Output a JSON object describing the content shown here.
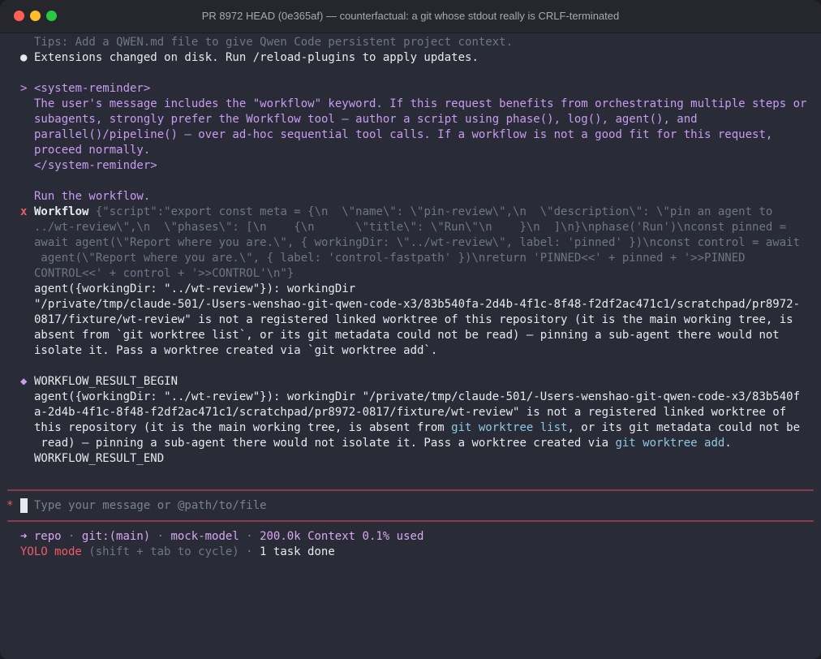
{
  "window": {
    "title": "PR 8972 HEAD (0e365af) — counterfactual: a git whose stdout really is CRLF-terminated"
  },
  "colors": {
    "background": "#292c36",
    "accent_purple": "#c99bf2",
    "error_red": "#ee5a6a",
    "separator": "#8a3a4c",
    "code_cyan": "#8ec7e6"
  },
  "icons": {
    "bullet": "●",
    "prompt": ">",
    "error": "x",
    "result": "◆",
    "input_marker": "*",
    "arrow": "➜"
  },
  "messages": {
    "tips": "Tips: Add a QWEN.md file to give Qwen Code persistent project context.",
    "extensions": "Extensions changed on disk. Run /reload-plugins to apply updates."
  },
  "reminder": {
    "open_tag": "<system-reminder>",
    "lines": [
      "The user's message includes the \"workflow\" keyword. If this request benefits from orchestrating multiple steps or",
      "subagents, strongly prefer the Workflow tool — author a script using phase(), log(), agent(), and",
      "parallel()/pipeline() — over ad-hoc sequential tool calls. If a workflow is not a good fit for this request,",
      "proceed normally."
    ],
    "close_tag": "</system-reminder>",
    "request": "Run the workflow."
  },
  "tool_call": {
    "name": "Workflow",
    "args_lines": [
      "{\"script\":\"export const meta = {\\n  \\\"name\\\": \\\"pin-review\\\",\\n  \\\"description\\\": \\\"pin an agent to",
      "../wt-review\\\",\\n  \\\"phases\\\": [\\n    {\\n      \\\"title\\\": \\\"Run\\\"\\n    }\\n  ]\\n}\\nphase('Run')\\nconst pinned =",
      "await agent(\\\"Report where you are.\\\", { workingDir: \\\"../wt-review\\\", label: 'pinned' })\\nconst control = await",
      " agent(\\\"Report where you are.\\\", { label: 'control-fastpath' })\\nreturn 'PINNED<<' + pinned + '>>PINNED",
      "CONTROL<<' + control + '>>CONTROL'\\n\"}"
    ],
    "error_lines": [
      "agent({workingDir: \"../wt-review\"}): workingDir",
      "\"/private/tmp/claude-501/-Users-wenshao-git-qwen-code-x3/83b540fa-2d4b-4f1c-8f48-f2df2ac471c1/scratchpad/pr8972-",
      "0817/fixture/wt-review\" is not a registered linked worktree of this repository (it is the main working tree, is",
      "absent from `git worktree list`, or its git metadata could not be read) — pinning a sub-agent there would not",
      "isolate it. Pass a worktree created via `git worktree add`."
    ]
  },
  "result": {
    "begin": "WORKFLOW_RESULT_BEGIN",
    "line1": "agent({workingDir: \"../wt-review\"}): workingDir \"/private/tmp/claude-501/-Users-wenshao-git-qwen-code-x3/83b540f",
    "line2": "a-2d4b-4f1c-8f48-f2df2ac471c1/scratchpad/pr8972-0817/fixture/wt-review\" is not a registered linked worktree of",
    "line3a": "this repository (it is the main working tree, is absent from ",
    "line3_code": "git worktree list",
    "line3b": ", or its git metadata could not be",
    "line4a": " read) — pinning a sub-agent there would not isolate it. Pass a worktree created via ",
    "line4_code": "git worktree add",
    "line4b": ".",
    "end": "WORKFLOW_RESULT_END"
  },
  "input": {
    "placeholder": "Type your message or @path/to/file"
  },
  "status": {
    "repo": "repo",
    "branch": "git:(main)",
    "model": "mock-model",
    "context": "200.0k Context 0.1% used",
    "separator": " · ",
    "yolo": "YOLO mode",
    "yolo_hint": "(shift + tab to cycle)",
    "tasks": "1 task done"
  }
}
